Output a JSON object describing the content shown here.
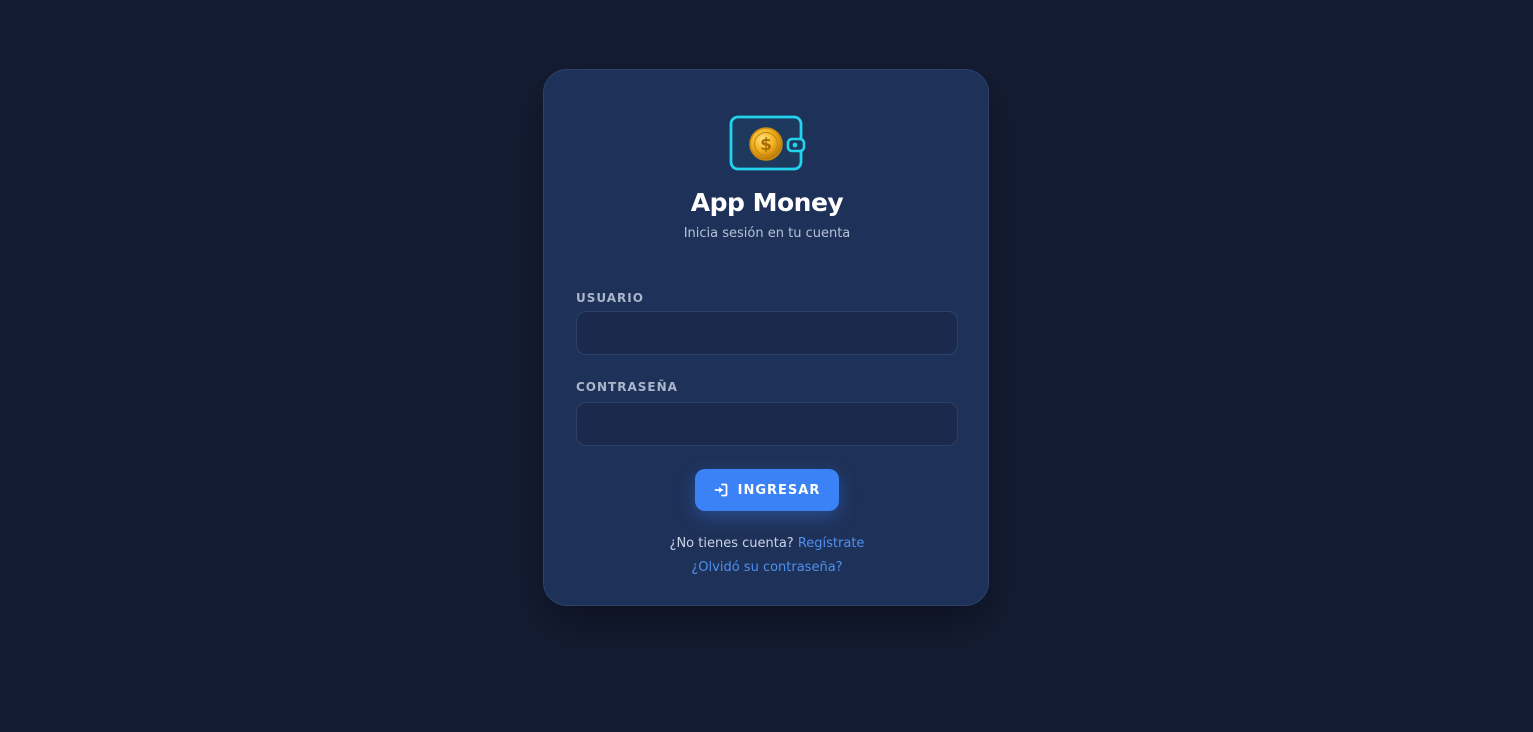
{
  "app": {
    "title": "App Money",
    "subtitle": "Inicia sesión en tu cuenta",
    "logo_icon": "wallet-coin-icon"
  },
  "form": {
    "username": {
      "label": "USUARIO",
      "value": "",
      "placeholder": ""
    },
    "password": {
      "label": "CONTRASEÑA",
      "value": "",
      "placeholder": ""
    },
    "submit": {
      "label": "INGRESAR",
      "icon": "login-icon"
    }
  },
  "footer": {
    "no_account_text": "¿No tienes cuenta?",
    "register_link": "Regístrate",
    "forgot_link": "¿Olvidó su contraseña?"
  },
  "colors": {
    "background": "#141c33",
    "card": "#1e3158",
    "accent": "#3b82f6",
    "link": "#4f8fef",
    "logo_cyan": "#22d3ee",
    "coin_gold": "#f2b01e"
  }
}
